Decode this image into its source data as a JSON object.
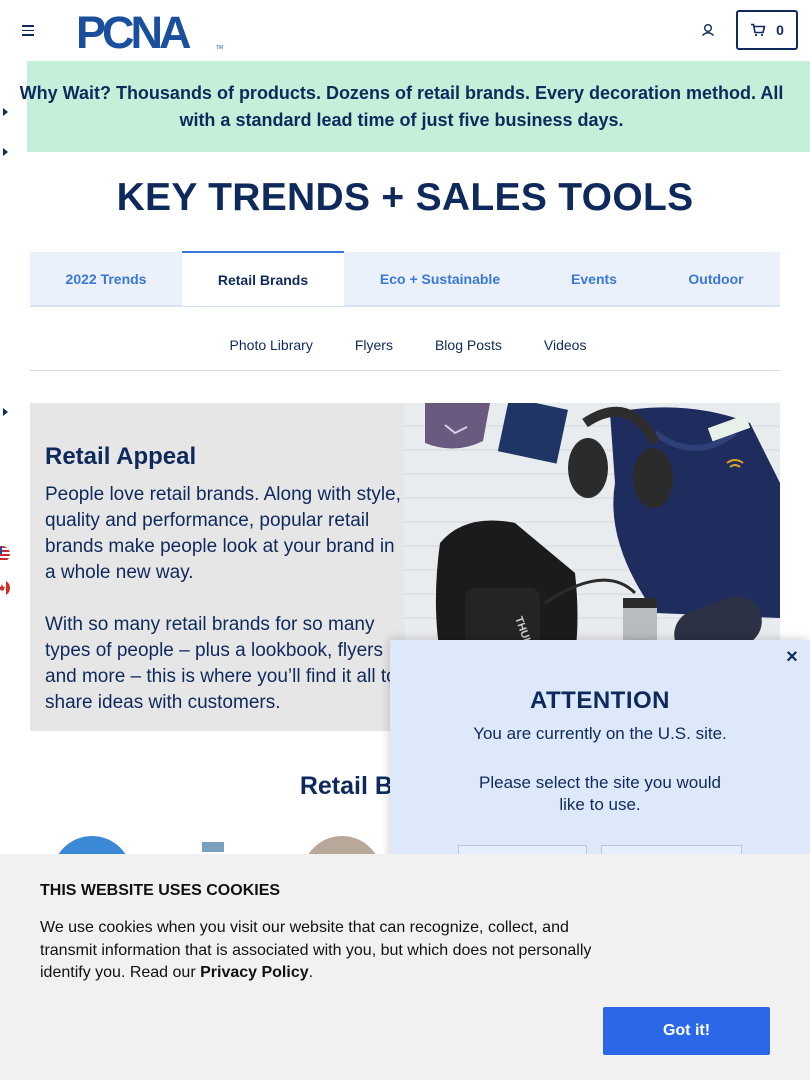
{
  "header": {
    "logo_text": "PCNA",
    "logo_tm": "TM",
    "cart_count": "0",
    "menu_icon": "hamburger-icon",
    "user_icon": "user-icon",
    "cart_icon": "cart-icon"
  },
  "promo": {
    "text": "Why Wait? Thousands of products. Dozens of retail brands. Every decoration method. All with a standard lead time of just five business days."
  },
  "page_title": "KEY TRENDS + SALES TOOLS",
  "tabs": [
    {
      "label": "2022 Trends",
      "active": false
    },
    {
      "label": "Retail Brands",
      "active": true
    },
    {
      "label": "Eco + Sustainable",
      "active": false
    },
    {
      "label": "Events",
      "active": false
    },
    {
      "label": "Outdoor",
      "active": false
    }
  ],
  "subnav": [
    "Photo Library",
    "Flyers",
    "Blog Posts",
    "Videos"
  ],
  "feature": {
    "heading": "Retail Appeal",
    "paragraph1": "People love retail brands. Along with style, quality and performance, popular retail brands make people look at your brand in a whole new way.",
    "paragraph2": "With so many retail brands for so many types of people – plus a lookbook, flyers and more – this is where you’ll find it all to share ideas with customers."
  },
  "section_title": "Retail Brands For",
  "modal": {
    "close": "×",
    "heading": "ATTENTION",
    "line1": "You are currently on the U.S. site.",
    "line2": "Please select the site you would like to use."
  },
  "cookie": {
    "heading": "THIS WEBSITE USES COOKIES",
    "text": "We use cookies when you visit our website that can recognize, collect, and transmit information that is associated with you, but which does not personally identify you. Read our ",
    "link": "Privacy Policy",
    "end": ".",
    "button": "Got it!"
  },
  "colors": {
    "navy": "#0e2a5c",
    "accent_blue": "#3a78d8",
    "promo_green": "#c4efd8",
    "button_blue": "#2b68e8",
    "modal_bg": "#dde8fa"
  }
}
